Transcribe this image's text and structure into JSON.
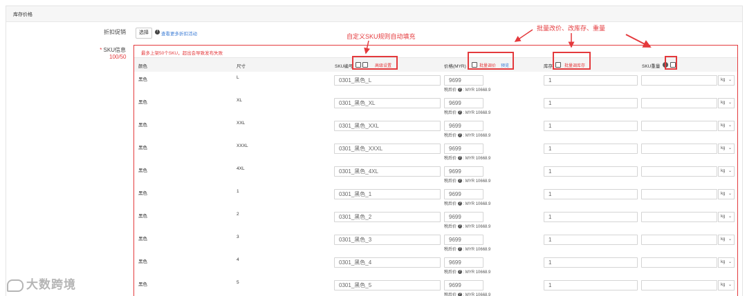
{
  "section": {
    "title": "库存价格"
  },
  "discount": {
    "label": "折扣促销",
    "select_label": "选择",
    "info_link": "查看更多折扣活动"
  },
  "sku": {
    "label": "SKU信息",
    "required_mark": "*",
    "count": "100/50",
    "warning": "最多上架50个SKU，超出会导致发布失败"
  },
  "columns": {
    "color": "颜色",
    "size": "尺寸",
    "sku_code": "SKU编号",
    "advanced_settings": "高级设置",
    "price": "价格(MYR)",
    "batch_price": "批量调价",
    "preview": "预览",
    "stock": "库存",
    "batch_stock": "批量调库存",
    "weight": "SKU重量"
  },
  "tax_label": "税后价",
  "rows": [
    {
      "color": "黑色",
      "size": "L",
      "sku": "0301_黑色_L",
      "price": "9699",
      "after_tax": "MYR 10668.9",
      "stock": "1",
      "unit": "kg"
    },
    {
      "color": "黑色",
      "size": "XL",
      "sku": "0301_黑色_XL",
      "price": "9699",
      "after_tax": "MYR 10668.9",
      "stock": "1",
      "unit": "kg"
    },
    {
      "color": "黑色",
      "size": "XXL",
      "sku": "0301_黑色_XXL",
      "price": "9699",
      "after_tax": "MYR 10668.9",
      "stock": "1",
      "unit": "kg"
    },
    {
      "color": "黑色",
      "size": "XXXL",
      "sku": "0301_黑色_XXXL",
      "price": "9699",
      "after_tax": "MYR 10668.9",
      "stock": "1",
      "unit": "kg"
    },
    {
      "color": "黑色",
      "size": "4XL",
      "sku": "0301_黑色_4XL",
      "price": "9699",
      "after_tax": "MYR 10668.9",
      "stock": "1",
      "unit": "kg"
    },
    {
      "color": "黑色",
      "size": "1",
      "sku": "0301_黑色_1",
      "price": "9699",
      "after_tax": "MYR 10668.9",
      "stock": "1",
      "unit": "kg"
    },
    {
      "color": "黑色",
      "size": "2",
      "sku": "0301_黑色_2",
      "price": "9699",
      "after_tax": "MYR 10668.9",
      "stock": "1",
      "unit": "kg"
    },
    {
      "color": "黑色",
      "size": "3",
      "sku": "0301_黑色_3",
      "price": "9699",
      "after_tax": "MYR 10668.9",
      "stock": "1",
      "unit": "kg"
    },
    {
      "color": "黑色",
      "size": "4",
      "sku": "0301_黑色_4",
      "price": "9699",
      "after_tax": "MYR 10668.9",
      "stock": "1",
      "unit": "kg"
    },
    {
      "color": "黑色",
      "size": "5",
      "sku": "0301_黑色_5",
      "price": "9699",
      "after_tax": "MYR 10668.9",
      "stock": "1",
      "unit": "kg"
    }
  ],
  "annotations": {
    "auto_fill": "自定义SKU规则自动填充",
    "batch_edit": "批量改价、改库存、重量"
  },
  "watermark": {
    "text": "大数跨境"
  },
  "colors": {
    "accent_red": "#e4393c",
    "link_blue": "#3a7bd5"
  }
}
